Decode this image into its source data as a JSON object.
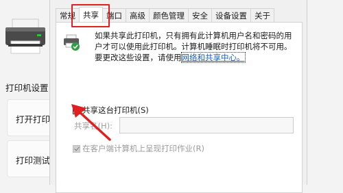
{
  "background_page": {
    "section_title": "打印机设置",
    "cards": [
      {
        "label": "打开打印"
      },
      {
        "label": "打印测试"
      }
    ]
  },
  "dialog": {
    "tabs": [
      {
        "label": "常规",
        "active": false
      },
      {
        "label": "共享",
        "active": true
      },
      {
        "label": "端口",
        "active": false
      },
      {
        "label": "高级",
        "active": false
      },
      {
        "label": "颜色管理",
        "active": false
      },
      {
        "label": "安全",
        "active": false
      },
      {
        "label": "设备设置",
        "active": false
      },
      {
        "label": "关于",
        "active": false
      }
    ],
    "share_info": {
      "text": "如果共享此打印机，只有拥有此计算机用户名和密码的用户才可以使用此打印机。计算机睡眠时打印机将不可用。要更改这些设置，请使用",
      "link": "网络和共享中心。"
    },
    "share_checkbox": {
      "label": "共享这台打印机(S)",
      "checked": false
    },
    "share_name": {
      "label": "共享名(H):",
      "value": ""
    },
    "render_checkbox": {
      "label": "在客户端计算机上呈现打印作业(R)",
      "checked": true,
      "disabled": true
    }
  },
  "colors": {
    "annotation_red": "#e02020",
    "link_blue": "#1a5fb4"
  },
  "icons": {
    "printer": "printer-icon",
    "share_printer": "shared-printer-icon"
  }
}
